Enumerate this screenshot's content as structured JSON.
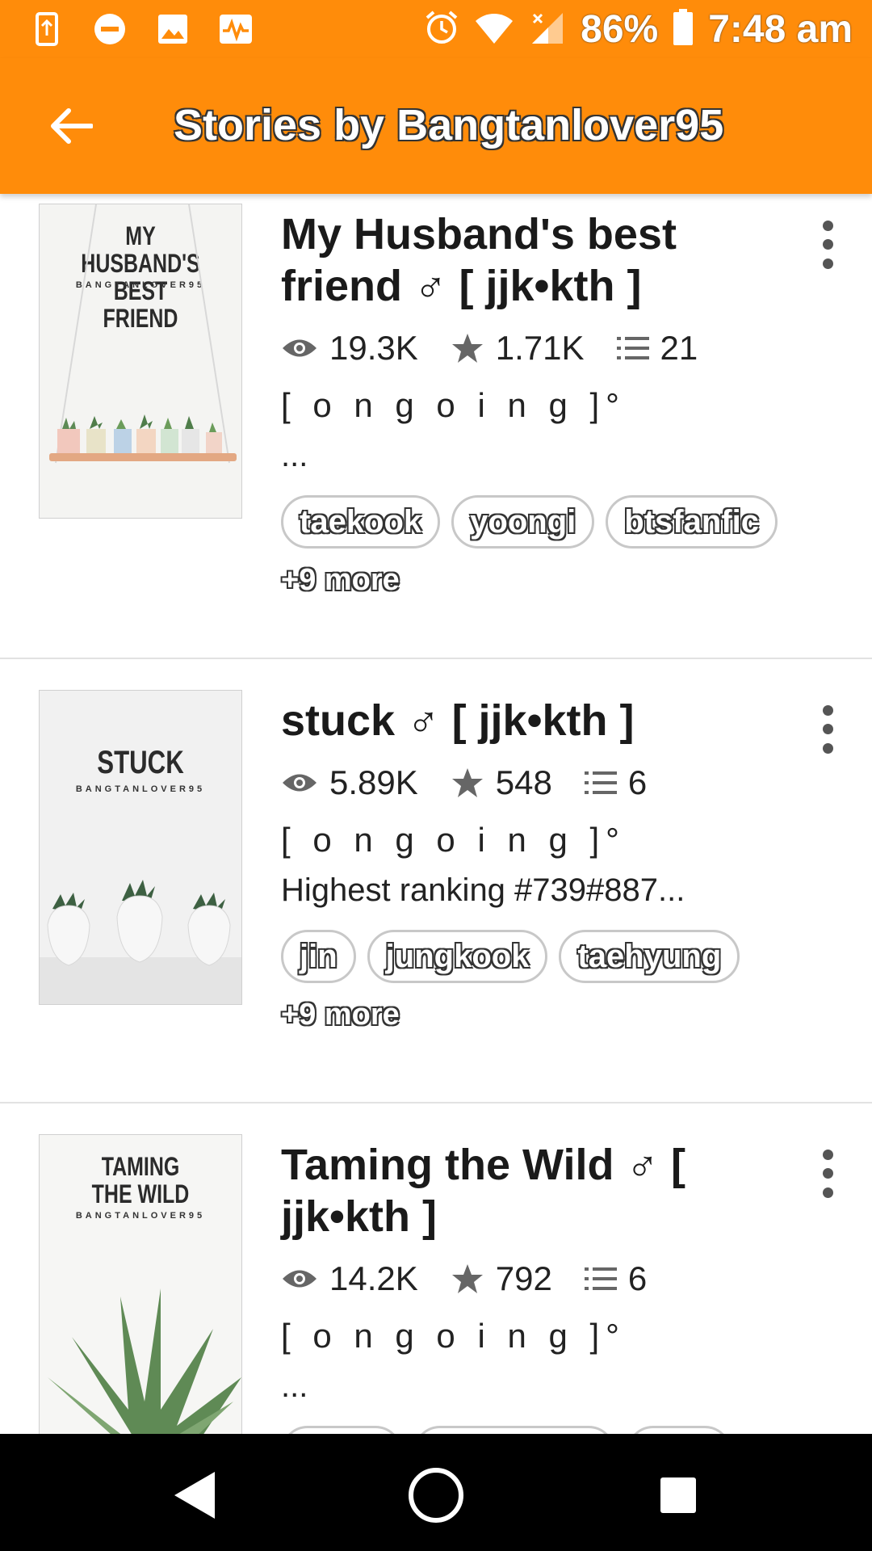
{
  "status_bar": {
    "battery": "86%",
    "time": "7:48 am"
  },
  "header": {
    "title": "Stories by Bangtanlover95"
  },
  "stories": [
    {
      "title": "My Husband's best friend ♂ [ jjk•kth ]",
      "cover_title": "MY HUSBAND'S BEST FRIEND",
      "cover_author": "BANGTANLOVER95",
      "reads": "19.3K",
      "votes": "1.71K",
      "parts": "21",
      "status": "[ o n g o i n g ]°",
      "description": "...",
      "tags": [
        "taekook",
        "yoongi",
        "btsfanfic"
      ],
      "more": "+9 more"
    },
    {
      "title": "stuck ♂ [ jjk•kth ]",
      "cover_title": "STUCK",
      "cover_author": "BANGTANLOVER95",
      "reads": "5.89K",
      "votes": "548",
      "parts": "6",
      "status": "[ o n g o i n g ]°",
      "description": "Highest ranking #739#887...",
      "tags": [
        "jin",
        "jungkook",
        "taehyung"
      ],
      "more": "+9 more"
    },
    {
      "title": "Taming the Wild ♂ [ jjk•kth ]",
      "cover_title": "TAMING THE WILD",
      "cover_author": "BANGTANLOVER95",
      "reads": "14.2K",
      "votes": "792",
      "parts": "6",
      "status": "[ o n g o i n g ]°",
      "description": "..."
    }
  ],
  "colors": {
    "accent": "#ff8c0a",
    "nav_bar": "#000000"
  },
  "icons": {
    "back": "arrow-left-icon",
    "reads": "eye-icon",
    "votes": "star-icon",
    "parts": "list-icon",
    "menu": "more-vertical-icon"
  }
}
